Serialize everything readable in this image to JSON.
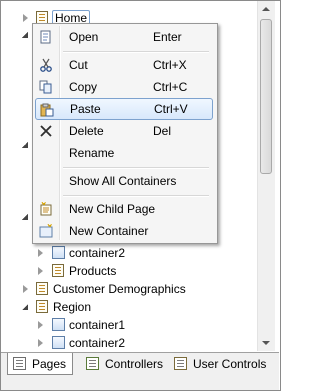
{
  "tree": {
    "root_label": "Home",
    "items_below": [
      {
        "label": "container2",
        "type": "container",
        "level": 2
      },
      {
        "label": "Products",
        "type": "page",
        "level": 2
      },
      {
        "label": "Customer Demographics",
        "type": "page",
        "level": 1
      },
      {
        "label": "Region",
        "type": "page",
        "level": 1
      },
      {
        "label": "container1",
        "type": "container",
        "level": 2
      },
      {
        "label": "container2",
        "type": "container",
        "level": 2
      }
    ]
  },
  "context_menu": {
    "items": [
      {
        "label": "Open",
        "shortcut": "Enter",
        "icon": "open-icon"
      },
      {
        "label": "Cut",
        "shortcut": "Ctrl+X",
        "icon": "scissors-icon"
      },
      {
        "label": "Copy",
        "shortcut": "Ctrl+C",
        "icon": "copy-icon"
      },
      {
        "label": "Paste",
        "shortcut": "Ctrl+V",
        "icon": "paste-icon",
        "highlighted": true
      },
      {
        "label": "Delete",
        "shortcut": "Del",
        "icon": "delete-x-icon"
      },
      {
        "label": "Rename",
        "shortcut": "",
        "icon": ""
      },
      {
        "label": "Show All Containers",
        "shortcut": "",
        "icon": ""
      },
      {
        "label": "New Child Page",
        "shortcut": "",
        "icon": "new-page-icon"
      },
      {
        "label": "New Container",
        "shortcut": "",
        "icon": "new-container-icon"
      }
    ]
  },
  "tabs": [
    {
      "label": "Pages",
      "active": true,
      "icon": "pages-icon"
    },
    {
      "label": "Controllers",
      "active": false,
      "icon": "controllers-icon"
    },
    {
      "label": "User Controls",
      "active": false,
      "icon": "user-controls-icon"
    }
  ],
  "colors": {
    "menu_highlight_border": "#7da2ce",
    "menu_background": "#f5f5f5",
    "tab_strip_background": "#f0f0f0"
  }
}
